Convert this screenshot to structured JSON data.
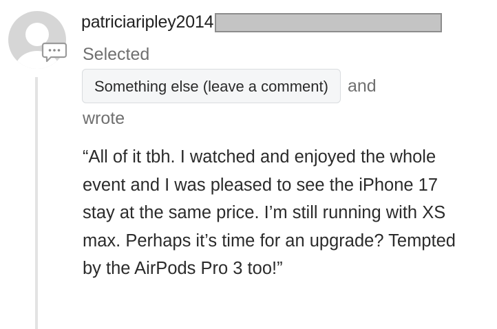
{
  "post": {
    "username": "patriciaripley2014",
    "selected_label": "Selected",
    "choice": "Something else (leave a comment)",
    "and_label": "and",
    "wrote_label": "wrote",
    "comment": "“All of it tbh. I watched and enjoyed the whole event and I was pleased to see the iPhone 17 stay at the same price. I’m still running with XS max. Perhaps it’s time for an upgrade? Tempted by the AirPods Pro 3 too!”"
  },
  "icons": {
    "avatar": "default-user-avatar-icon",
    "badge": "comment-bubble-icon"
  },
  "colors": {
    "avatar_gray": "#c9c9c9",
    "redaction_fill": "#c4c4c4",
    "pill_background": "#f5f6f7",
    "muted_text": "#6f6f6f"
  }
}
